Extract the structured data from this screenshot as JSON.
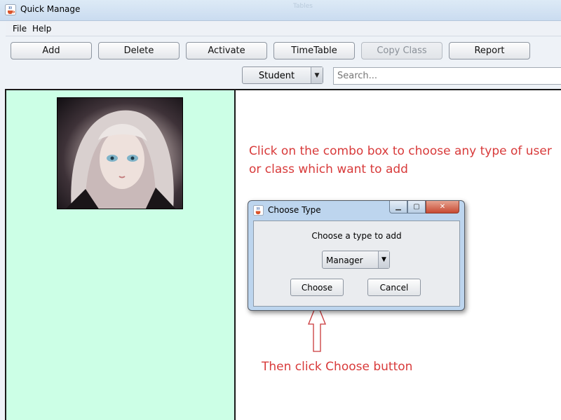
{
  "window": {
    "title": "Quick Manage",
    "ghost_title": "Tables",
    "icon": "java-cup-icon"
  },
  "menu": {
    "items": [
      "File",
      "Help"
    ]
  },
  "toolbar": {
    "buttons": [
      {
        "label": "Add",
        "enabled": true
      },
      {
        "label": "Delete",
        "enabled": true
      },
      {
        "label": "Activate",
        "enabled": true
      },
      {
        "label": "TimeTable",
        "enabled": true
      },
      {
        "label": "Copy Class",
        "enabled": false
      },
      {
        "label": "Report",
        "enabled": true
      }
    ],
    "user_type_combo": {
      "value": "Student",
      "icon": "dropdown-arrow-icon"
    },
    "search": {
      "placeholder": "Search..."
    }
  },
  "annotations": {
    "combo_hint": "Click on the combo box to choose any type of user or class which want to add",
    "button_hint": "Then click Choose button",
    "color": "#d83a3a"
  },
  "dialog": {
    "title": "Choose Type",
    "prompt": "Choose a type to add",
    "combo_value": "Manager",
    "choose_label": "Choose",
    "cancel_label": "Cancel",
    "controls": [
      "minimize-icon",
      "maximize-icon",
      "close-icon"
    ]
  },
  "colors": {
    "left_panel": "#ccffe6",
    "right_panel": "#ffffff",
    "window_chrome": "#cadcf0"
  }
}
